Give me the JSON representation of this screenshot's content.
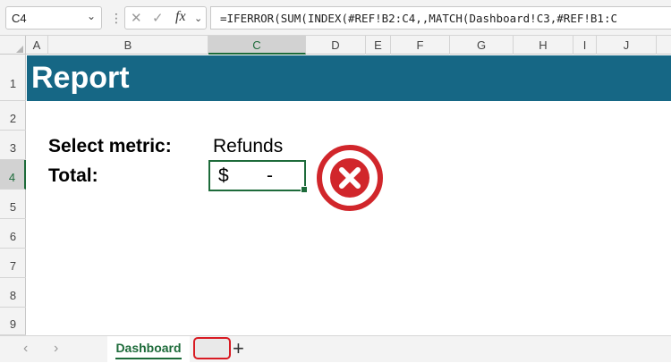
{
  "formula_bar": {
    "name_box": "C4",
    "formula": "=IFERROR(SUM(INDEX(#REF!B2:C4,,MATCH(Dashboard!C3,#REF!B1:C",
    "icons": [
      "cancel-icon",
      "enter-icon",
      "function-icon"
    ]
  },
  "columns": [
    "A",
    "B",
    "C",
    "D",
    "E",
    "F",
    "G",
    "H",
    "I",
    "J"
  ],
  "rows": [
    "1",
    "2",
    "3",
    "4",
    "5",
    "6",
    "7",
    "8",
    "9"
  ],
  "selected_cell": "C4",
  "sheet": {
    "banner_title": "Report",
    "banner_color": "#166785",
    "select_label": "Select metric:",
    "select_value": "Refunds",
    "total_label": "Total:",
    "total_currency": "$",
    "total_value": "-"
  },
  "error_icon": "error-x-icon",
  "tabs": {
    "active": "Dashboard",
    "add_icon": "+"
  },
  "accent_color": "#1d6b3a",
  "highlight_color": "#d81b23"
}
